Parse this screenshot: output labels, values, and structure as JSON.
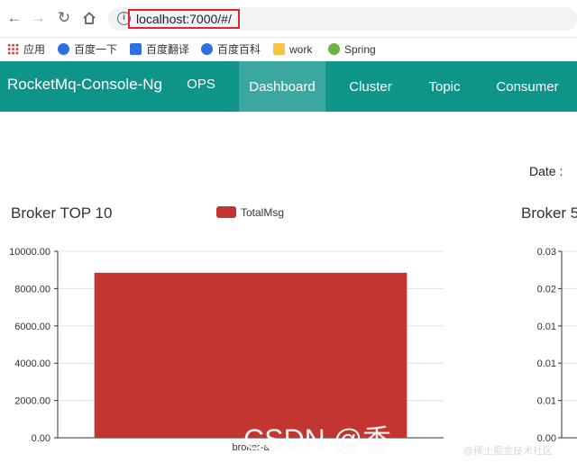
{
  "browser": {
    "back_icon": "arrow-left-icon",
    "forward_icon": "arrow-right-icon",
    "reload_icon": "reload-icon",
    "home_icon": "home-icon",
    "info_icon": "info-icon",
    "url": "localhost:7000/#/",
    "url_highlight_color": "#d9282f"
  },
  "bookmarks": [
    {
      "label": "应用",
      "icon": "apps-grid-icon"
    },
    {
      "label": "百度一下",
      "icon": "baidu-paw-icon"
    },
    {
      "label": "百度翻译",
      "icon": "translate-icon"
    },
    {
      "label": "百度百科",
      "icon": "baidu-paw-icon"
    },
    {
      "label": "work",
      "icon": "folder-icon"
    },
    {
      "label": "Spring",
      "icon": "spring-leaf-icon"
    }
  ],
  "app": {
    "brand": "RocketMq-Console-Ng",
    "header_color": "#0e9488",
    "nav": [
      {
        "label": "OPS",
        "active": false
      },
      {
        "label": "Dashboard",
        "active": true
      },
      {
        "label": "Cluster",
        "active": false
      },
      {
        "label": "Topic",
        "active": false
      },
      {
        "label": "Consumer",
        "active": false
      }
    ]
  },
  "dashboard": {
    "date_label": "Date :",
    "chart2_title": "Broker 5",
    "chart2_ticks": [
      "0.03",
      "0.02",
      "0.01",
      "0.01",
      "0.01",
      "0.00"
    ]
  },
  "chart_data": [
    {
      "type": "bar",
      "title": "Broker TOP 10",
      "series": [
        {
          "name": "TotalMsg",
          "values": [
            8850
          ]
        }
      ],
      "categories": [
        "broker-a"
      ],
      "ytick_labels": [
        "0.00",
        "2000.00",
        "4000.00",
        "6000.00",
        "8000.00",
        "10000.00"
      ],
      "ylim": [
        0,
        10000
      ],
      "color": "#c23531",
      "grid": true,
      "legend": "top-center"
    }
  ],
  "watermarks": {
    "main": "CSDN @香",
    "footer": "@稀土掘金技术社区"
  }
}
